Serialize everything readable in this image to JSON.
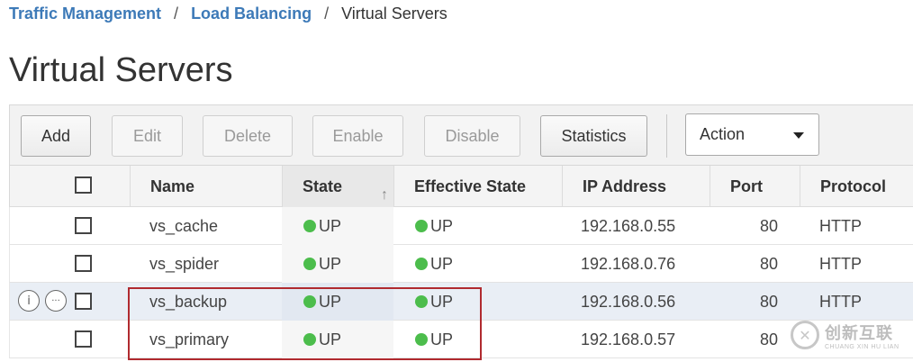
{
  "breadcrumb": {
    "items": [
      "Traffic Management",
      "Load Balancing"
    ],
    "separator": "/",
    "current": "Virtual Servers"
  },
  "page_title": "Virtual Servers",
  "toolbar": {
    "add": "Add",
    "edit": "Edit",
    "delete": "Delete",
    "enable": "Enable",
    "disable": "Disable",
    "statistics": "Statistics",
    "action": "Action"
  },
  "table": {
    "headers": {
      "name": "Name",
      "state": "State",
      "effective_state": "Effective State",
      "ip": "IP Address",
      "port": "Port",
      "protocol": "Protocol"
    },
    "sorted_column": "State",
    "rows": [
      {
        "name": "vs_cache",
        "state": "UP",
        "effective_state": "UP",
        "ip": "192.168.0.55",
        "port": "80",
        "protocol": "HTTP"
      },
      {
        "name": "vs_spider",
        "state": "UP",
        "effective_state": "UP",
        "ip": "192.168.0.76",
        "port": "80",
        "protocol": "HTTP"
      },
      {
        "name": "vs_backup",
        "state": "UP",
        "effective_state": "UP",
        "ip": "192.168.0.56",
        "port": "80",
        "protocol": "HTTP"
      },
      {
        "name": "vs_primary",
        "state": "UP",
        "effective_state": "UP",
        "ip": "192.168.0.57",
        "port": "80",
        "protocol": ""
      }
    ],
    "hover_row_icons": {
      "info": "i",
      "more": "···"
    }
  },
  "watermark": {
    "cn": "创新互联",
    "en": "CHUANG XIN HU LIAN",
    "logo": "✕"
  },
  "colors": {
    "link": "#3d7ab8",
    "up_dot": "#4cbd4c",
    "highlight": "#b02a2f"
  }
}
